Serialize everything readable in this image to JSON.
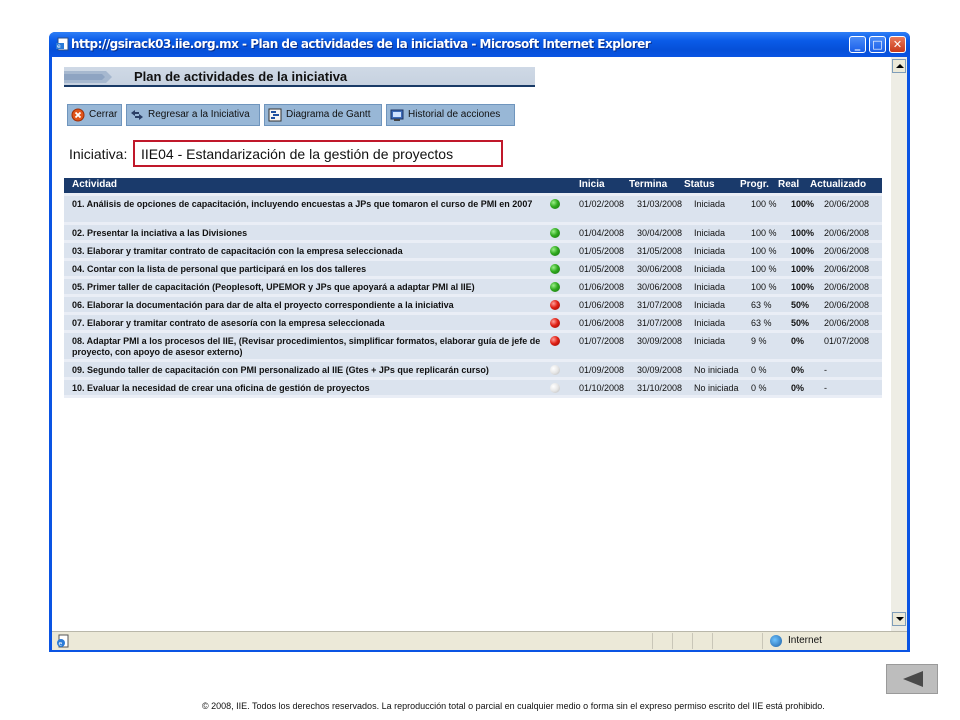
{
  "window": {
    "title": "http://gsirack03.iie.org.mx - Plan de actividades de la iniciativa - Microsoft Internet Explorer",
    "buttons": {
      "minimize": "_",
      "maximize": "□",
      "close": "✕"
    }
  },
  "page": {
    "heading": "Plan de actividades de la iniciativa",
    "toolbar": [
      {
        "label": "Cerrar",
        "icon": "close-icon"
      },
      {
        "label": "Regresar a la Iniciativa",
        "icon": "back-arrows-icon"
      },
      {
        "label": "Diagrama de Gantt",
        "icon": "gantt-chart-icon"
      },
      {
        "label": "Historial de acciones",
        "icon": "history-icon"
      }
    ],
    "initiative_label": "Iniciativa:",
    "initiative_name": "IIE04 - Estandarización de la gestión de proyectos"
  },
  "table": {
    "headers": {
      "actividad": "Actividad",
      "inicia": "Inicia",
      "termina": "Termina",
      "status": "Status",
      "progr": "Progr.",
      "real": "Real",
      "actualizado": "Actualizado"
    },
    "rows": [
      {
        "actividad": "01. Análisis de opciones de capacitación, incluyendo encuestas a JPs que tomaron el curso de PMI en 2007",
        "light": "green",
        "inicia": "01/02/2008",
        "termina": "31/03/2008",
        "status": "Iniciada",
        "progr": "100 %",
        "real": "100%",
        "actualizado": "20/06/2008"
      },
      {
        "actividad": "02. Presentar la inciativa a las Divisiones",
        "light": "green",
        "inicia": "01/04/2008",
        "termina": "30/04/2008",
        "status": "Iniciada",
        "progr": "100 %",
        "real": "100%",
        "actualizado": "20/06/2008"
      },
      {
        "actividad": "03. Elaborar y tramitar contrato de capacitación con la empresa seleccionada",
        "light": "green",
        "inicia": "01/05/2008",
        "termina": "31/05/2008",
        "status": "Iniciada",
        "progr": "100 %",
        "real": "100%",
        "actualizado": "20/06/2008"
      },
      {
        "actividad": "04. Contar con la lista de personal que participará en los dos talleres",
        "light": "green",
        "inicia": "01/05/2008",
        "termina": "30/06/2008",
        "status": "Iniciada",
        "progr": "100 %",
        "real": "100%",
        "actualizado": "20/06/2008"
      },
      {
        "actividad": "05. Primer taller de capacitación (Peoplesoft, UPEMOR y JPs que apoyará a adaptar PMI al IIE)",
        "light": "green",
        "inicia": "01/06/2008",
        "termina": "30/06/2008",
        "status": "Iniciada",
        "progr": "100 %",
        "real": "100%",
        "actualizado": "20/06/2008"
      },
      {
        "actividad": "06. Elaborar la documentación para dar de alta el proyecto correspondiente a la iniciativa",
        "light": "red",
        "inicia": "01/06/2008",
        "termina": "31/07/2008",
        "status": "Iniciada",
        "progr": "63 %",
        "real": "50%",
        "actualizado": "20/06/2008"
      },
      {
        "actividad": "07. Elaborar y tramitar contrato de asesoría con la empresa seleccionada",
        "light": "red",
        "inicia": "01/06/2008",
        "termina": "31/07/2008",
        "status": "Iniciada",
        "progr": "63 %",
        "real": "50%",
        "actualizado": "20/06/2008"
      },
      {
        "actividad": "08. Adaptar PMI a los procesos del IIE, (Revisar procedimientos, simplificar formatos, elaborar guía de jefe de proyecto, con apoyo de asesor externo)",
        "light": "red",
        "inicia": "01/07/2008",
        "termina": "30/09/2008",
        "status": "Iniciada",
        "progr": "9 %",
        "real": "0%",
        "actualizado": "01/07/2008"
      },
      {
        "actividad": "09. Segundo taller de capacitación con PMI personalizado al IIE (Gtes + JPs que replicarán curso)",
        "light": "none",
        "inicia": "01/09/2008",
        "termina": "30/09/2008",
        "status": "No iniciada",
        "progr": "0 %",
        "real": "0%",
        "actualizado": "-"
      },
      {
        "actividad": "10. Evaluar la necesidad de crear una oficina de gestión de proyectos",
        "light": "none",
        "inicia": "01/10/2008",
        "termina": "31/10/2008",
        "status": "No iniciada",
        "progr": "0 %",
        "real": "0%",
        "actualizado": "-"
      }
    ]
  },
  "statusbar": {
    "zone": "Internet"
  },
  "footer": "© 2008, IIE. Todos los derechos reservados. La reproducción total o parcial en cualquier medio o forma sin el expreso permiso escrito del IIE está prohibido."
}
